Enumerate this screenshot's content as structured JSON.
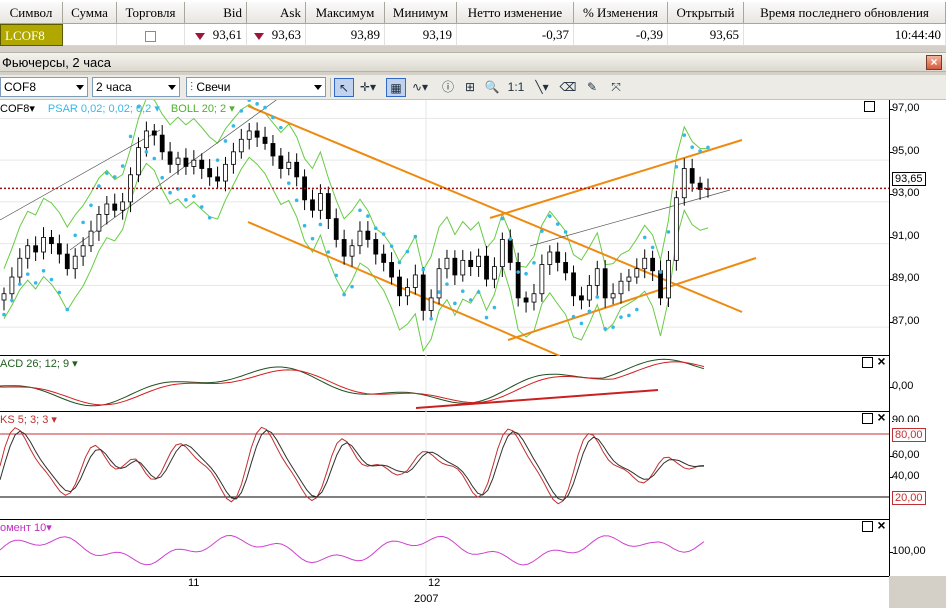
{
  "quotes": {
    "columns": [
      "Символ",
      "Сумма",
      "Торговля",
      "Bid",
      "Ask",
      "Максимум",
      "Минимум",
      "Нетто изменение",
      "% Изменения",
      "Открытый",
      "Время последнего обновления"
    ],
    "row": {
      "symbol": "LCOF8",
      "amount": "",
      "bid": "93,61",
      "ask": "93,63",
      "high": "93,89",
      "low": "93,19",
      "net_change": "-0,37",
      "pct_change": "-0,39",
      "open": "93,65",
      "updated": "10:44:40"
    }
  },
  "window": {
    "title": "Фьючерсы, 2 часа",
    "close_glyph": "×"
  },
  "toolbar": {
    "symbol_combo": "COF8",
    "interval_combo": "2 часа",
    "chart_type_combo": "Свечи",
    "tools": [
      {
        "name": "cursor-tool",
        "glyph": "↖",
        "active": true
      },
      {
        "name": "crosshair-tool",
        "glyph": "✛▾",
        "active": false
      },
      {
        "name": "grid-tool",
        "glyph": "▦",
        "active": true
      },
      {
        "name": "indicators-tool",
        "glyph": "∿▾",
        "active": false
      },
      {
        "name": "info-tool",
        "glyph": "ⓘ",
        "active": false
      },
      {
        "name": "add-object-tool",
        "glyph": "⊞",
        "active": false
      },
      {
        "name": "zoom-tool",
        "glyph": "🔍",
        "active": false
      },
      {
        "name": "scale-tool",
        "glyph": "1:1",
        "active": false
      },
      {
        "name": "line-tool",
        "glyph": "╲▾",
        "active": false
      },
      {
        "name": "eraser-tool",
        "glyph": "⌫",
        "active": false
      },
      {
        "name": "paint-tool",
        "glyph": "✎",
        "active": false
      },
      {
        "name": "fibonacci-tool",
        "glyph": "⤧",
        "active": false
      }
    ]
  },
  "panes": {
    "price": {
      "label_symbol": "COF8▾",
      "label_psar": "PSAR 0,02; 0,02; 0,2 ▾",
      "label_boll": "BOLL 20; 2 ▾",
      "ticks": [
        "97,00",
        "95,00",
        "93,00",
        "91,00",
        "89,00",
        "87,00"
      ],
      "last_price": "93,65"
    },
    "macd": {
      "label": "ACD 26; 12; 9 ▾",
      "ticks": [
        "0,00"
      ]
    },
    "stoch": {
      "label": "KS 5; 3; 3 ▾",
      "ticks": [
        "60,00",
        "40,00",
        "90,00"
      ],
      "upper_tag": "80,00",
      "lower_tag": "20,00"
    },
    "momentum": {
      "label": "омент 10▾",
      "ticks": [
        "100,00"
      ]
    }
  },
  "xaxis": {
    "labels": [
      "11",
      "12"
    ],
    "year": "2007"
  },
  "colors": {
    "candle": "#000000",
    "psar": "#35b8e8",
    "bollinger": "#66cc44",
    "channel": "#ee8a10",
    "macd_main": "#205020",
    "macd_signal": "#d02020",
    "stoch_k": "#c03030",
    "stoch_d": "#303030",
    "momentum": "#d040d0",
    "last_price_line": "#a01010"
  },
  "chart_data": {
    "type": "candlestick",
    "symbol": "COF8",
    "interval": "2 часа",
    "ylim": [
      86,
      97.5
    ],
    "close_series": [
      88.6,
      89.4,
      90.3,
      90.9,
      90.6,
      91.3,
      91.0,
      90.5,
      89.8,
      90.4,
      90.9,
      91.6,
      92.4,
      92.9,
      92.6,
      93.0,
      94.3,
      95.6,
      96.4,
      96.2,
      95.4,
      94.8,
      95.1,
      94.7,
      95.0,
      94.6,
      94.2,
      94.0,
      94.8,
      95.4,
      96.0,
      96.4,
      96.1,
      95.8,
      95.2,
      94.6,
      94.9,
      94.2,
      93.1,
      92.6,
      93.4,
      92.2,
      91.2,
      90.4,
      90.9,
      91.6,
      91.2,
      90.5,
      90.1,
      89.4,
      88.5,
      88.9,
      89.5,
      87.8,
      88.4,
      89.8,
      90.3,
      89.5,
      90.2,
      89.9,
      90.4,
      89.3,
      89.9,
      91.2,
      90.1,
      88.4,
      88.2,
      88.6,
      90.0,
      90.6,
      90.1,
      89.6,
      88.5,
      88.3,
      89.0,
      89.8,
      88.4,
      88.6,
      89.2,
      89.4,
      89.8,
      90.3,
      89.7,
      88.4,
      90.2,
      93.2,
      94.6,
      93.9,
      93.6,
      93.65
    ],
    "notable_points": [
      "last 93,65"
    ]
  }
}
